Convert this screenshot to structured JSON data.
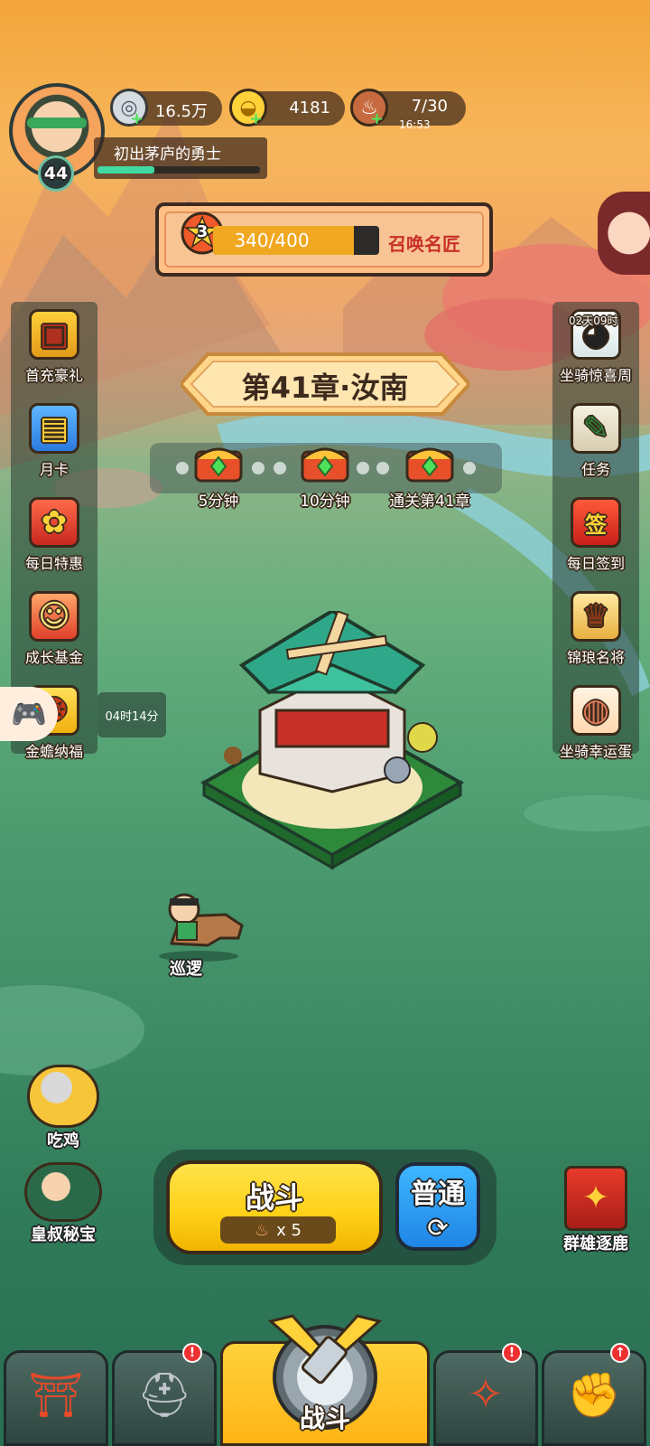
{
  "player": {
    "level": "44",
    "title": "初出茅庐的勇士",
    "xp_progress": 0.35
  },
  "resources": {
    "silver": "16.5万",
    "gold": "4181",
    "stamina": "7/30",
    "stamina_timer": "16:53"
  },
  "summon": {
    "star_level": "3",
    "progress_text": "340/400",
    "progress": 0.85,
    "label": "召唤名匠"
  },
  "chapter": {
    "title": "第41章·汝南",
    "rewards": [
      {
        "label": "5分钟"
      },
      {
        "label": "10分钟"
      },
      {
        "label": "通关第41章"
      }
    ]
  },
  "left_menu": [
    {
      "label": "首充豪礼",
      "icon": "treasure-chest-icon"
    },
    {
      "label": "月卡",
      "icon": "month-card-icon"
    },
    {
      "label": "每日特惠",
      "icon": "gift-bag-icon"
    },
    {
      "label": "成长基金",
      "icon": "fund-icon"
    },
    {
      "label": "金蟾纳福",
      "icon": "golden-toad-icon"
    }
  ],
  "left_timer": "04时14分",
  "right_menu": [
    {
      "label": "坐骑惊喜周",
      "icon": "panda-mount-icon",
      "badge": "02天09时"
    },
    {
      "label": "任务",
      "icon": "quest-scroll-icon"
    },
    {
      "label": "每日签到",
      "icon": "sign-in-icon",
      "badge_char": "签"
    },
    {
      "label": "锦琅名将",
      "icon": "general-icon"
    },
    {
      "label": "坐骑幸运蛋",
      "icon": "mount-egg-icon"
    }
  ],
  "map": {
    "patrol_label": "巡逻"
  },
  "npcs": [
    {
      "label": "吃鸡"
    },
    {
      "label": "皇叔秘宝"
    }
  ],
  "event_right": {
    "label": "群雄逐鹿"
  },
  "battle": {
    "label": "战斗",
    "cost": "x 5",
    "mode_label": "普通",
    "mode_icon": "refresh-icon"
  },
  "bottom_nav": {
    "center_label": "战斗",
    "tabs": [
      {
        "icon": "city-gate-icon"
      },
      {
        "icon": "helmet-icon",
        "alert": "!"
      },
      {
        "icon": "battle-icon"
      },
      {
        "icon": "weapon-stars-icon",
        "alert": "!"
      },
      {
        "icon": "fist-upgrade-icon",
        "alert": "↑"
      }
    ]
  },
  "colors": {
    "accent_yellow": "#ffd21a",
    "accent_blue": "#1f85e6",
    "alert_red": "#ee3030",
    "xp_green": "#41d9a2"
  }
}
